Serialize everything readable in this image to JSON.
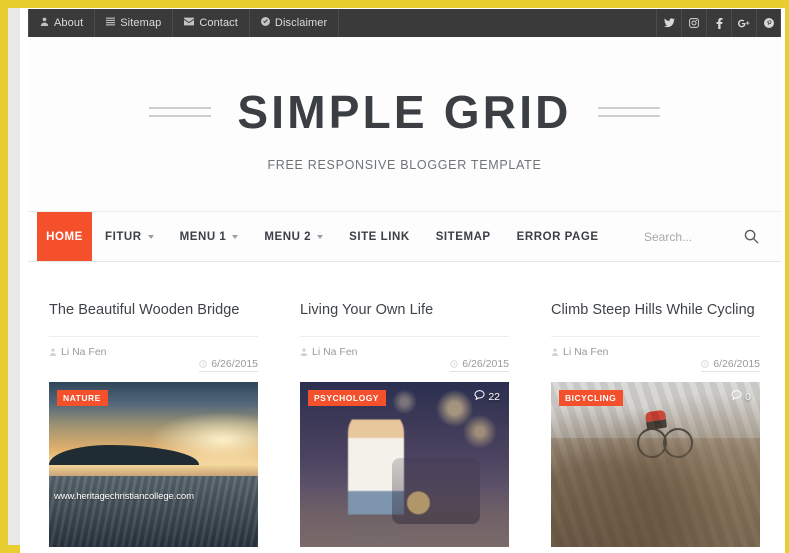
{
  "topbar": {
    "links": [
      {
        "label": "About",
        "icon": "user-icon"
      },
      {
        "label": "Sitemap",
        "icon": "list-icon"
      },
      {
        "label": "Contact",
        "icon": "envelope-icon"
      },
      {
        "label": "Disclaimer",
        "icon": "check-circle-icon"
      }
    ],
    "social": [
      {
        "name": "twitter"
      },
      {
        "name": "instagram"
      },
      {
        "name": "facebook"
      },
      {
        "name": "google-plus"
      },
      {
        "name": "pinterest"
      }
    ]
  },
  "masthead": {
    "title": "SIMPLE GRID",
    "tagline": "FREE RESPONSIVE BLOGGER TEMPLATE"
  },
  "nav": {
    "items": [
      {
        "label": "HOME",
        "active": true,
        "dropdown": false
      },
      {
        "label": "FITUR",
        "active": false,
        "dropdown": true
      },
      {
        "label": "MENU 1",
        "active": false,
        "dropdown": true
      },
      {
        "label": "MENU 2",
        "active": false,
        "dropdown": true
      },
      {
        "label": "SITE LINK",
        "active": false,
        "dropdown": false
      },
      {
        "label": "SITEMAP",
        "active": false,
        "dropdown": false
      },
      {
        "label": "ERROR PAGE",
        "active": false,
        "dropdown": false
      }
    ],
    "search": {
      "placeholder": "Search...",
      "value": "",
      "icon": "search-icon"
    }
  },
  "posts": [
    {
      "title": "The Beautiful Wooden Bridge",
      "author": "Li Na Fen",
      "date": "6/26/2015",
      "category": "NATURE",
      "comments": "",
      "watermark": "www.heritagechristiancollege.com"
    },
    {
      "title": "Living Your Own Life",
      "author": "Li Na Fen",
      "date": "6/26/2015",
      "category": "PSYCHOLOGY",
      "comments": "22",
      "watermark": ""
    },
    {
      "title": "Climb Steep Hills While Cycling",
      "author": "Li Na Fen",
      "date": "6/26/2015",
      "category": "BICYCLING",
      "comments": "0",
      "watermark": ""
    }
  ],
  "colors": {
    "frame": "#e8cf2f",
    "accent": "#f4502c",
    "topbar": "#3a3a3a",
    "title": "#3b3f43"
  }
}
